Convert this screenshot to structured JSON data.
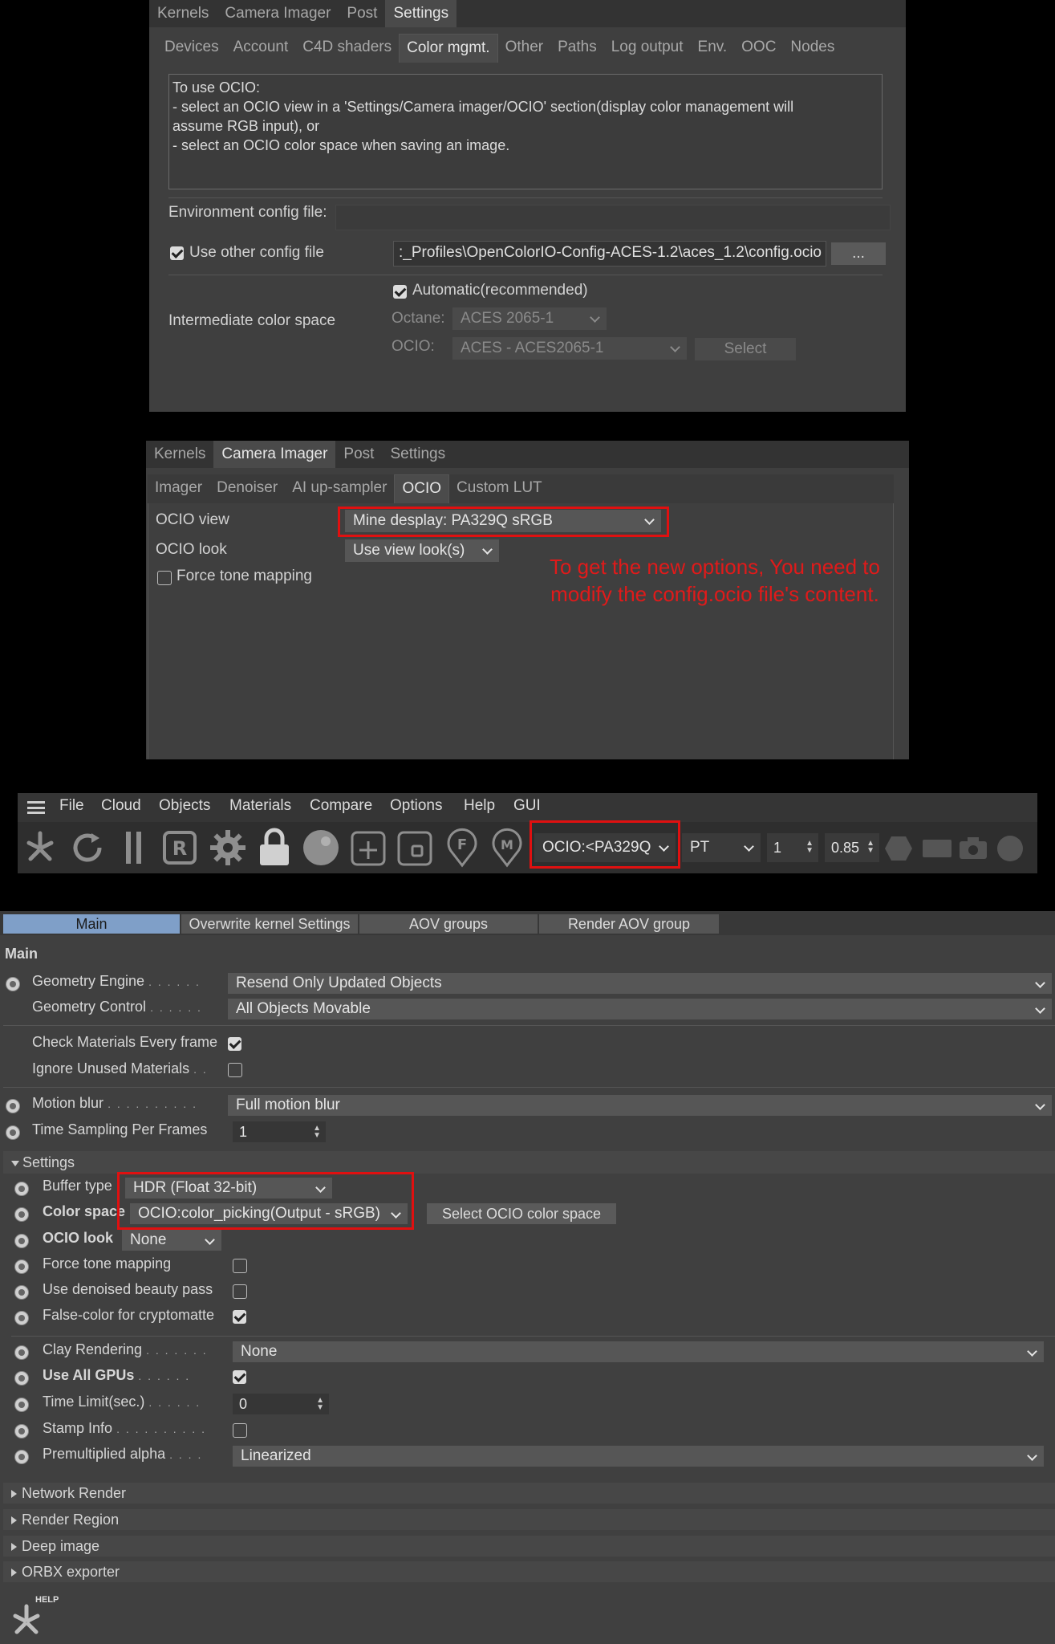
{
  "panel1": {
    "tabs": [
      "Kernels",
      "Camera Imager",
      "Post",
      "Settings"
    ],
    "active_tab": "Settings",
    "subtabs": [
      "Devices",
      "Account",
      "C4D shaders",
      "Color mgmt.",
      "Other",
      "Paths",
      "Log output",
      "Env.",
      "OOC",
      "Nodes"
    ],
    "active_subtab": "Color mgmt.",
    "info_line1": "To use OCIO:",
    "info_line2": "- select an OCIO view in a 'Settings/Camera imager/OCIO' section(display color management will",
    "info_line3": "assume RGB input), or",
    "info_line4": "- select an OCIO color space when saving an image.",
    "env_config_label": "Environment config file:",
    "use_other_label": "Use other config file",
    "config_path": ":_Profiles\\OpenColorIO-Config-ACES-1.2\\aces_1.2\\config.ocio",
    "browse_button": "...",
    "automatic_label": "Automatic(recommended)",
    "intermediate_label": "Intermediate color space",
    "octane_label": "Octane:",
    "octane_value": "ACES 2065-1",
    "ocio_label": "OCIO:",
    "ocio_value": "ACES - ACES2065-1",
    "select_button": "Select"
  },
  "panel2": {
    "tabs": [
      "Kernels",
      "Camera Imager",
      "Post",
      "Settings"
    ],
    "active_tab": "Camera Imager",
    "subtabs": [
      "Imager",
      "Denoiser",
      "AI up-sampler",
      "OCIO",
      "Custom LUT"
    ],
    "active_subtab": "OCIO",
    "ocio_view_label": "OCIO view",
    "ocio_view_value": "Mine desplay: PA329Q sRGB",
    "ocio_look_label": "OCIO look",
    "ocio_look_value": "Use view look(s)",
    "force_tone_label": "Force tone mapping",
    "annotation_line1": "To get the new options, You need to",
    "annotation_line2": "modify the config.ocio file's content.",
    "annotation_color": "#e01a1a"
  },
  "panel3": {
    "menu": [
      "File",
      "Cloud",
      "Objects",
      "Materials",
      "Compare",
      "Options",
      "Help",
      "GUI"
    ],
    "toolbar_icons": [
      "octane-logo-icon",
      "refresh-icon",
      "pause-icon",
      "r-icon",
      "gear-icon",
      "lock-icon",
      "sphere-icon",
      "add-region-icon",
      "region-icon",
      "f-pin-icon",
      "m-pin-icon"
    ],
    "ocio_select": "OCIO:<PA329Q",
    "kernel_select": "PT",
    "value1": "1",
    "value2": "0.85",
    "right_icons": [
      "hexagon-icon",
      "rectangle-icon",
      "camera-icon",
      "circle-icon"
    ]
  },
  "panel4": {
    "tabs": [
      "Main",
      "Overwrite kernel Settings",
      "AOV groups",
      "Render AOV group"
    ],
    "active_tab": "Main",
    "heading": "Main",
    "geometry_engine_label": "Geometry Engine",
    "geometry_engine_value": "Resend Only Updated Objects",
    "geometry_control_label": "Geometry Control",
    "geometry_control_value": "All Objects Movable",
    "check_materials_label": "Check Materials Every frame",
    "ignore_unused_label": "Ignore Unused Materials",
    "motion_blur_label": "Motion blur",
    "motion_blur_value": "Full motion blur",
    "time_sampling_label": "Time Sampling Per Frames",
    "time_sampling_value": "1",
    "settings_section": "Settings",
    "buffer_type_label": "Buffer type",
    "buffer_type_value": "HDR (Float 32-bit)",
    "color_space_label": "Color space",
    "color_space_value": "OCIO:color_picking(Output - sRGB)",
    "select_ocio_button": "Select OCIO color space",
    "ocio_look_label": "OCIO look",
    "ocio_look_value": "None",
    "force_tone_label": "Force tone mapping",
    "denoised_label": "Use denoised beauty pass",
    "false_color_label": "False-color for cryptomatte",
    "clay_label": "Clay Rendering",
    "clay_value": "None",
    "use_all_gpus_label": "Use All GPUs",
    "time_limit_label": "Time Limit(sec.)",
    "time_limit_value": "0",
    "stamp_info_label": "Stamp Info",
    "premultiplied_label": "Premultiplied alpha",
    "premultiplied_value": "Linearized",
    "network_render": "Network Render",
    "render_region": "Render Region",
    "deep_image": "Deep image",
    "orbx_exporter": "ORBX exporter",
    "help_label": "HELP"
  }
}
